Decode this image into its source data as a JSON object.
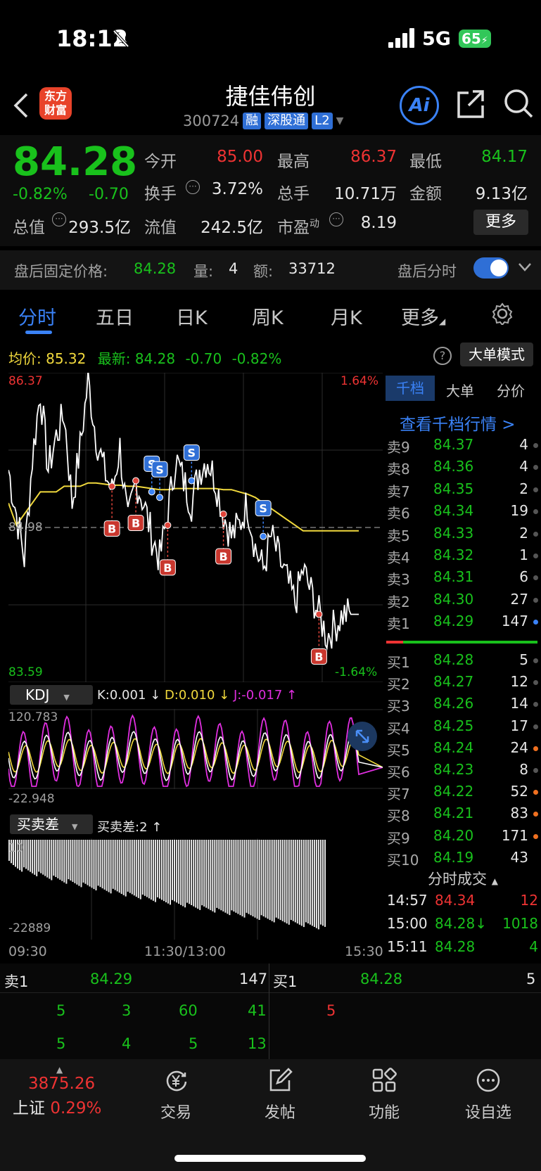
{
  "status": {
    "time": "18:12",
    "network": "5G",
    "battery": "65"
  },
  "header": {
    "logo_line1": "东方",
    "logo_line2": "财富",
    "title": "捷佳伟创",
    "code": "300724",
    "tags": [
      "融",
      "深股通",
      "L2"
    ],
    "ai_label": "Ai"
  },
  "quote": {
    "price": "84.28",
    "change_pct": "-0.82%",
    "change": "-0.70",
    "open_label": "今开",
    "open": "85.00",
    "high_label": "最高",
    "high": "86.37",
    "low_label": "最低",
    "low": "84.17",
    "turnover_label": "换手",
    "turnover": "3.72%",
    "volume_label": "总手",
    "volume": "10.71万",
    "amount_label": "金额",
    "amount": "9.13亿",
    "mktcap_label": "总值",
    "mktcap": "293.5亿",
    "float_label": "流值",
    "float": "242.5亿",
    "pe_label": "市盈",
    "pe_sup": "动",
    "pe": "8.19",
    "more": "更多"
  },
  "after_hours": {
    "label": "盘后固定价格:",
    "price": "84.28",
    "vol_label": "量:",
    "vol": "4",
    "amt_label": "额:",
    "amt": "33712",
    "toggle_label": "盘后分时",
    "toggle_on": true
  },
  "tabs": [
    "分时",
    "五日",
    "日K",
    "周K",
    "月K",
    "更多"
  ],
  "avg_row": {
    "avg_label": "均价:",
    "avg": "85.32",
    "latest_label": "最新:",
    "latest": "84.28",
    "chg": "-0.70",
    "pct": "-0.82%",
    "mode_btn": "大单模式"
  },
  "chart_data": [
    {
      "type": "line",
      "y_top": "86.37",
      "y_mid": "84.98",
      "y_bottom": "83.59",
      "pct_top": "1.64%",
      "pct_bottom": "-1.64%",
      "x_labels": [
        "09:30",
        "11:30/13:00",
        "15:30"
      ],
      "ylim": [
        83.59,
        86.37
      ],
      "series": [
        {
          "values": [
            85.5,
            85.1,
            84.7,
            85.6,
            86.2,
            85.5,
            85.8,
            86.0,
            85.2,
            85.7,
            86.3,
            85.8,
            85.5,
            85.3,
            85.7,
            85.0,
            85.4,
            85.2,
            84.9,
            84.7,
            85.1,
            85.6,
            85.4,
            85.2,
            85.5,
            85.6,
            85.4,
            85.1,
            84.9,
            85.0,
            85.2,
            84.8,
            84.6,
            84.9,
            84.7,
            84.5,
            84.3,
            84.6,
            84.4,
            84.2,
            84.0,
            84.1,
            84.2,
            84.2
          ]
        },
        {
          "values": [
            85.2,
            85.0,
            85.1,
            85.2,
            85.3,
            85.3,
            85.3,
            85.35,
            85.35,
            85.35,
            85.38,
            85.38,
            85.37,
            85.36,
            85.36,
            85.35,
            85.35,
            85.34,
            85.33,
            85.32,
            85.32,
            85.33,
            85.33,
            85.33,
            85.33,
            85.33,
            85.33,
            85.32,
            85.32,
            85.3,
            85.28,
            85.25,
            85.2,
            85.15,
            85.1,
            85.05,
            85.0,
            84.95,
            84.95,
            84.95,
            84.95,
            84.95,
            84.95,
            84.95
          ]
        }
      ],
      "markers": [
        {
          "label": "B",
          "x": 13,
          "y": 85.35
        },
        {
          "label": "B",
          "x": 16,
          "y": 85.4
        },
        {
          "label": "S",
          "x": 18,
          "y": 85.3
        },
        {
          "label": "S",
          "x": 19,
          "y": 85.25
        },
        {
          "label": "B",
          "x": 20,
          "y": 85.0
        },
        {
          "label": "S",
          "x": 23,
          "y": 85.4
        },
        {
          "label": "B",
          "x": 27,
          "y": 85.1
        },
        {
          "label": "S",
          "x": 32,
          "y": 84.9
        },
        {
          "label": "B",
          "x": 39,
          "y": 84.2
        }
      ]
    },
    {
      "type": "line",
      "indicator": "KDJ",
      "k": "K:0.001 ↓",
      "d": "D:0.010 ↓",
      "j": "J:-0.017 ↑",
      "ylim": [
        -22.948,
        120.783
      ]
    },
    {
      "type": "bar",
      "indicator": "买卖差",
      "value_text": "买卖差:2 ↑",
      "ylim": [
        -22889,
        10
      ]
    }
  ],
  "side": {
    "tabs": [
      "千档",
      "大单",
      "分价"
    ],
    "link": "查看千档行情 >",
    "asks": [
      {
        "name": "卖9",
        "price": "84.37",
        "vol": "4"
      },
      {
        "name": "卖8",
        "price": "84.36",
        "vol": "4"
      },
      {
        "name": "卖7",
        "price": "84.35",
        "vol": "2"
      },
      {
        "name": "卖6",
        "price": "84.34",
        "vol": "19"
      },
      {
        "name": "卖5",
        "price": "84.33",
        "vol": "2"
      },
      {
        "name": "卖4",
        "price": "84.32",
        "vol": "1"
      },
      {
        "name": "卖3",
        "price": "84.31",
        "vol": "6"
      },
      {
        "name": "卖2",
        "price": "84.30",
        "vol": "27"
      },
      {
        "name": "卖1",
        "price": "84.29",
        "vol": "147"
      }
    ],
    "bids": [
      {
        "name": "买1",
        "price": "84.28",
        "vol": "5"
      },
      {
        "name": "买2",
        "price": "84.27",
        "vol": "12"
      },
      {
        "name": "买3",
        "price": "84.26",
        "vol": "14"
      },
      {
        "name": "买4",
        "price": "84.25",
        "vol": "17"
      },
      {
        "name": "买5",
        "price": "84.24",
        "vol": "24"
      },
      {
        "name": "买6",
        "price": "84.23",
        "vol": "8"
      },
      {
        "name": "买7",
        "price": "84.22",
        "vol": "52"
      },
      {
        "name": "买8",
        "price": "84.21",
        "vol": "83"
      },
      {
        "name": "买9",
        "price": "84.20",
        "vol": "171"
      },
      {
        "name": "买10",
        "price": "84.19",
        "vol": "43"
      }
    ],
    "ticks_title": "分时成交",
    "ticks": [
      {
        "time": "14:57",
        "price": "84.34",
        "vol": "12"
      },
      {
        "time": "15:00",
        "price": "84.28↓",
        "vol": "1018"
      },
      {
        "time": "15:11",
        "price": "84.28",
        "vol": "4"
      }
    ]
  },
  "depth": {
    "ask_label": "卖1",
    "ask_price": "84.29",
    "ask_vol": "147",
    "bid_label": "买1",
    "bid_price": "84.28",
    "bid_vol": "5",
    "ask_row1": [
      "5",
      "3",
      "60",
      "41"
    ],
    "ask_row2": [
      "5",
      "4",
      "5",
      "13"
    ],
    "bid_row1": [
      "5"
    ]
  },
  "footer": {
    "index_value": "3875.26",
    "index_name": "上证",
    "index_pct": "0.29%",
    "items": [
      "交易",
      "发帖",
      "功能",
      "设自选"
    ]
  },
  "colors": {
    "up": "#ee3333",
    "down": "#19c11c",
    "accent": "#3a82f7",
    "avg_line": "#f1d93d"
  }
}
